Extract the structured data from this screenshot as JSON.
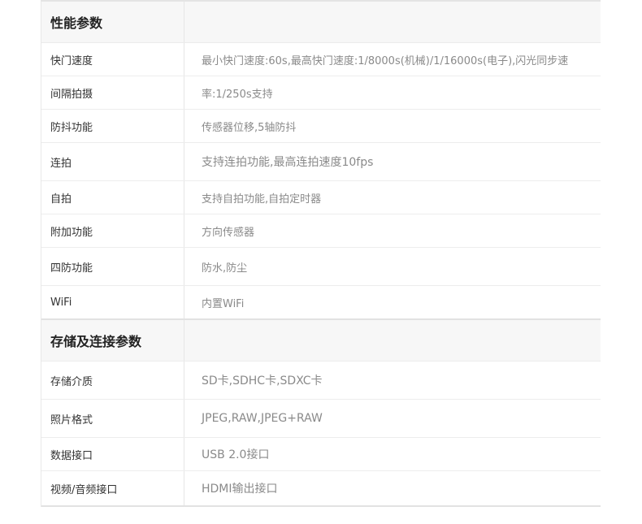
{
  "sections": [
    {
      "title": "性能参数",
      "rows": [
        {
          "label": "快门速度",
          "value": "最小快门速度:60s,最高快门速度:1/8000s(机械)/1/16000s(电子),闪光同步速"
        },
        {
          "label": "间隔拍摄",
          "value": "率:1/250s支持"
        },
        {
          "label": "防抖功能",
          "value": "传感器位移,5轴防抖"
        },
        {
          "label": "连拍",
          "value": "支持连拍功能,最高连拍速度10fps"
        },
        {
          "label": "自拍",
          "value": "支持自拍功能,自拍定时器"
        },
        {
          "label": "附加功能",
          "value": "方向传感器"
        },
        {
          "label": "四防功能",
          "value": "防水,防尘"
        },
        {
          "label": "WiFi",
          "value": "内置WiFi"
        }
      ]
    },
    {
      "title": "存储及连接参数",
      "rows": [
        {
          "label": "存储介质",
          "value": "SD卡,SDHC卡,SDXC卡"
        },
        {
          "label": "照片格式",
          "value": "JPEG,RAW,JPEG+RAW"
        },
        {
          "label": "数据接口",
          "value": "USB 2.0接口"
        },
        {
          "label": "视频/音频接口",
          "value": "HDMI输出接口"
        }
      ]
    }
  ]
}
